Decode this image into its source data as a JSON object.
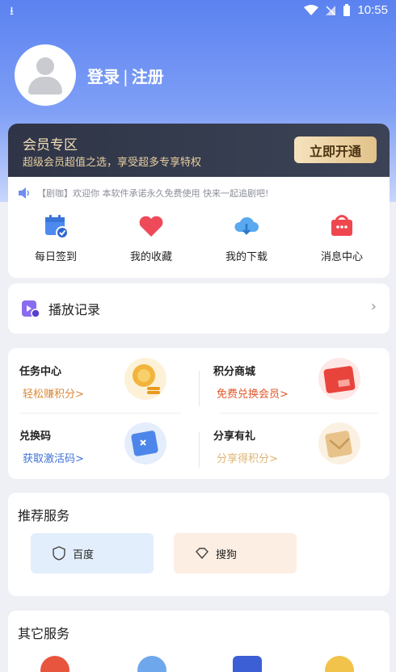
{
  "status": {
    "time": "10:55"
  },
  "profile": {
    "login": "登录",
    "separator": "|",
    "register": "注册"
  },
  "vip": {
    "title": "会员专区",
    "subtitle": "超级会员超值之选，享受超多专享特权",
    "button": "立即开通"
  },
  "notice": "【剧咖】欢迎你 本软件承诺永久免费使用 快来一起追剧吧!",
  "shortcuts": [
    {
      "label": "每日签到",
      "icon": "calendar-check-icon"
    },
    {
      "label": "我的收藏",
      "icon": "heart-icon"
    },
    {
      "label": "我的下载",
      "icon": "cloud-download-icon"
    },
    {
      "label": "消息中心",
      "icon": "message-box-icon"
    }
  ],
  "history": {
    "label": "播放记录"
  },
  "tasks": [
    {
      "title": "任务中心",
      "sub": "轻松赚积分>"
    },
    {
      "title": "积分商城",
      "sub": "免费兑换会员>"
    },
    {
      "title": "兑换码",
      "sub": "获取激活码>"
    },
    {
      "title": "分享有礼",
      "sub": "分享得积分>"
    }
  ],
  "recommend": {
    "title": "推荐服务",
    "items": [
      {
        "label": "百度",
        "color": "#e3eefc"
      },
      {
        "label": "搜狗",
        "color": "#fdeee3"
      }
    ]
  },
  "other": {
    "title": "其它服务"
  },
  "colors": {
    "accent": "#5b82f0",
    "gold": "#e2c28a",
    "orange": "#d98a3a"
  }
}
